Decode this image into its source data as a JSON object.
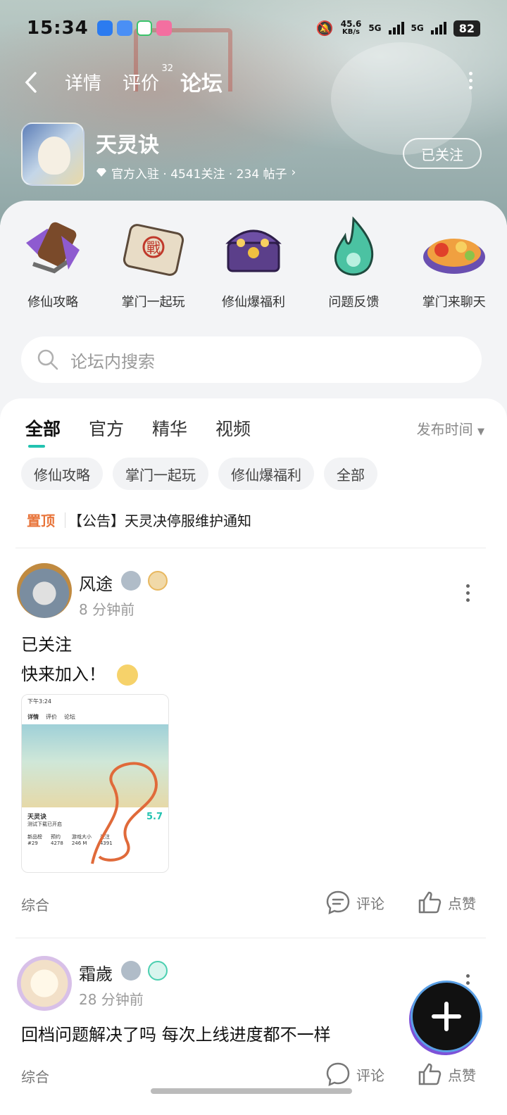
{
  "status_bar": {
    "time": "15:34",
    "net_speed": "45.6",
    "net_unit": "KB/s",
    "sim1": "5G",
    "sim2": "5G",
    "battery": "82"
  },
  "nav": {
    "tabs": [
      {
        "label": "详情"
      },
      {
        "label": "评价",
        "badge": "32"
      },
      {
        "label": "论坛"
      }
    ],
    "active_tab": "论坛"
  },
  "game": {
    "name": "天灵诀",
    "meta": "官方入驻 · 4541关注 · 234 帖子",
    "follow_label": "已关注"
  },
  "categories": [
    {
      "label": "修仙攻略",
      "icon": "scroll-chain-icon"
    },
    {
      "label": "掌门一起玩",
      "icon": "battle-scroll-icon"
    },
    {
      "label": "修仙爆福利",
      "icon": "treasure-chest-icon"
    },
    {
      "label": "问题反馈",
      "icon": "green-flame-icon"
    },
    {
      "label": "掌门来聊天",
      "icon": "food-plate-icon"
    }
  ],
  "search": {
    "placeholder": "论坛内搜索"
  },
  "feed": {
    "tabs": [
      "全部",
      "官方",
      "精华",
      "视频"
    ],
    "sort_label": "发布时间",
    "chips": [
      "修仙攻略",
      "掌门一起玩",
      "修仙爆福利",
      "全部"
    ],
    "pinned": {
      "tag": "置顶",
      "title": "【公告】天灵决停服维护通知"
    }
  },
  "posts": [
    {
      "author": "风途",
      "time": "8 分钟前",
      "lines": [
        "已关注",
        "快来加入！"
      ],
      "category": "综合",
      "comment_label": "评论",
      "like_label": "点赞",
      "screenshot": {
        "status": "下午3:24",
        "tabs": [
          "详情",
          "评价",
          "论坛"
        ],
        "game": "天灵诀",
        "sub": "测试下载已开启",
        "score": "5.7",
        "stats": [
          [
            "新品榜",
            "#29"
          ],
          [
            "预约",
            "4278"
          ],
          [
            "游戏大小",
            "246 M"
          ],
          [
            "关注",
            "4391"
          ]
        ]
      }
    },
    {
      "author": "霜歲",
      "time": "28 分钟前",
      "lines": [
        "回档问题解决了吗 每次上线进度都不一样"
      ],
      "category": "综合",
      "comment_label": "评论",
      "like_label": "点赞"
    }
  ],
  "colors": {
    "accent": "#22c2b0",
    "pin": "#e8743a"
  }
}
